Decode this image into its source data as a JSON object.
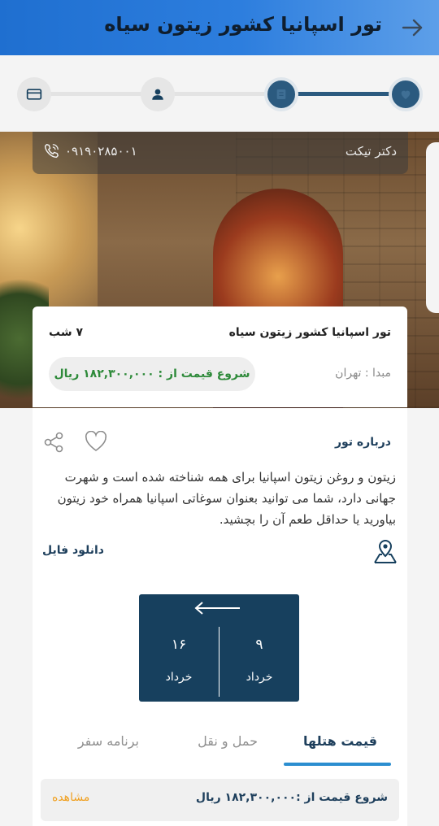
{
  "header": {
    "title": "تور اسپانیا کشور زیتون سیاه",
    "back_icon": "arrow-right-icon"
  },
  "stepper": {
    "steps": [
      {
        "icon": "heart-icon",
        "state": "done"
      },
      {
        "icon": "list-icon",
        "state": "done"
      },
      {
        "icon": "user-icon",
        "state": "idle"
      },
      {
        "icon": "credit-card-icon",
        "state": "idle"
      }
    ],
    "active_color": "#2b5a7f"
  },
  "agency": {
    "name": "دکتر تیکت",
    "phone": "۰۹۱۹۰۲۸۵۰۰۱"
  },
  "summary": {
    "tour_name": "تور اسپانیا کشور زیتون سیاه",
    "nights": "۷ شب",
    "origin": "مبدا : تهران",
    "price": "شروع قیمت از : ۱۸۲,۳۰۰,۰۰۰ ریال"
  },
  "details": {
    "about_title": "درباره تور",
    "description": "زیتون و روغن زیتون اسپانیا برای همه شناخته شده است و شهرت جهانی دارد، شما می توانید بعنوان سوغاتی اسپانیا همراه خود زیتون بیاورید یا حداقل طعم آن را بچشید.",
    "download": "دانلود فایل"
  },
  "dates": {
    "start_day": "۹",
    "start_month": "خرداد",
    "end_day": "۱۶",
    "end_month": "خرداد"
  },
  "tabs": [
    {
      "label": "قیمت هتلها",
      "active": true
    },
    {
      "label": "حمل و نقل",
      "active": false
    },
    {
      "label": "برنامه سفر",
      "active": false
    }
  ],
  "hotel_row": {
    "price": "شروع قیمت از :۱۸۲,۳۰۰,۰۰۰ ریال",
    "view": "مشاهده"
  },
  "colors": {
    "brand": "#1f6fd0",
    "navy": "#17405e",
    "price_green": "#2e8a3a",
    "view_orange": "#f0a020",
    "tab_underline": "#2b8ed0"
  }
}
